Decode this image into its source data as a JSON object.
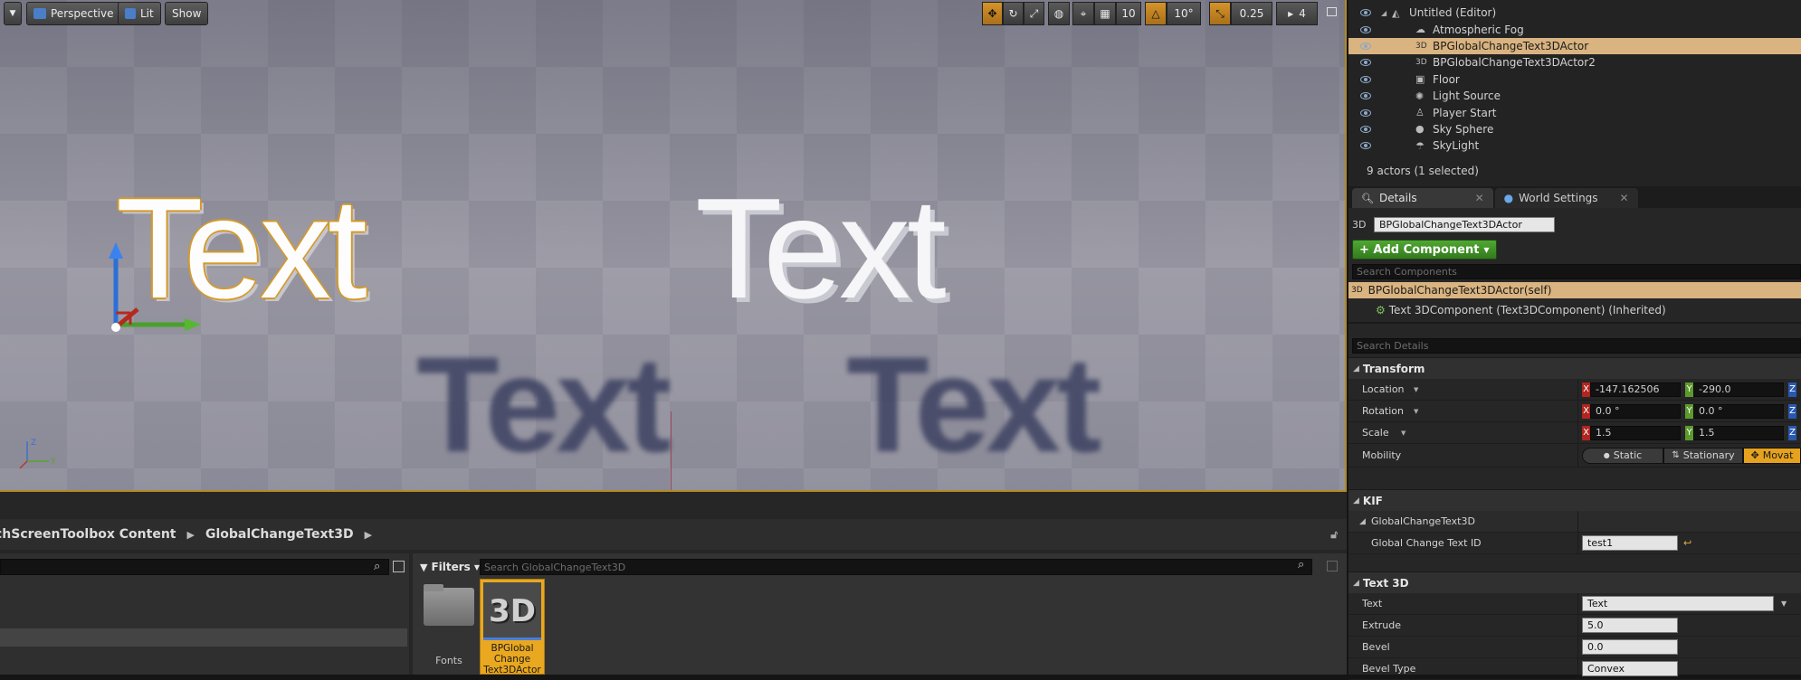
{
  "viewport": {
    "buttons": {
      "perspective": "Perspective",
      "lit": "Lit",
      "show": "Show"
    },
    "snap": {
      "grid": "10",
      "rotation": "10°",
      "scale": "0.25",
      "camera_speed": "4"
    },
    "scene_texts": [
      "Text",
      "Text"
    ],
    "reflection_texts": [
      "Text",
      "Text"
    ]
  },
  "content_browser": {
    "breadcrumbs": [
      "chScreenToolbox Content",
      "GlobalChangeText3D"
    ],
    "filters_label": "Filters",
    "search_placeholder": "Search GlobalChangeText3D",
    "assets": [
      {
        "label": "Fonts",
        "type": "folder"
      },
      {
        "label": "BPGlobal Change Text3DActor",
        "type": "blueprint",
        "thumb": "3D",
        "selected": true
      }
    ]
  },
  "outliner": {
    "items": [
      {
        "label": "Untitled (Editor)",
        "icon": "world-icon",
        "selected": false
      },
      {
        "label": "Atmospheric Fog",
        "icon": "fog-icon",
        "selected": false
      },
      {
        "label": "BPGlobalChangeText3DActor",
        "icon": "text3d-icon",
        "selected": true
      },
      {
        "label": "BPGlobalChangeText3DActor2",
        "icon": "text3d-icon",
        "selected": false
      },
      {
        "label": "Floor",
        "icon": "mesh-icon",
        "selected": false
      },
      {
        "label": "Light Source",
        "icon": "light-icon",
        "selected": false
      },
      {
        "label": "Player Start",
        "icon": "player-icon",
        "selected": false
      },
      {
        "label": "Sky Sphere",
        "icon": "sphere-icon",
        "selected": false
      },
      {
        "label": "SkyLight",
        "icon": "skylight-icon",
        "selected": false
      }
    ],
    "status": "9 actors (1 selected)"
  },
  "details": {
    "tabs": [
      "Details",
      "World Settings"
    ],
    "name_prefix": "3D",
    "actor_name": "BPGlobalChangeText3DActor",
    "add_component": "+ Add Component",
    "search_components": "Search Components",
    "self_component": "BPGlobalChangeText3DActor(self)",
    "child_component": "Text 3DComponent (Text3DComponent) (Inherited)",
    "search_details": "Search Details",
    "transform": {
      "title": "Transform",
      "location_label": "Location",
      "rotation_label": "Rotation",
      "scale_label": "Scale",
      "mobility_label": "Mobility",
      "location": {
        "x": "-147.162506",
        "y": "-290.0"
      },
      "rotation": {
        "x": "0.0 °",
        "y": "0.0 °"
      },
      "scale": {
        "x": "1.5",
        "y": "1.5"
      },
      "mobility_options": [
        "Static",
        "Stationary",
        "Movat"
      ]
    },
    "kif": {
      "title": "KIF",
      "sub": "GlobalChangeText3D",
      "field_label": "Global Change Text ID",
      "field_value": "test1"
    },
    "text3d": {
      "title": "Text 3D",
      "text_label": "Text",
      "text_value": "Text",
      "extrude_label": "Extrude",
      "extrude_value": "5.0",
      "bevel_label": "Bevel",
      "bevel_value": "0.0",
      "bevel_type_label": "Bevel Type",
      "bevel_type_value": "Convex"
    }
  }
}
